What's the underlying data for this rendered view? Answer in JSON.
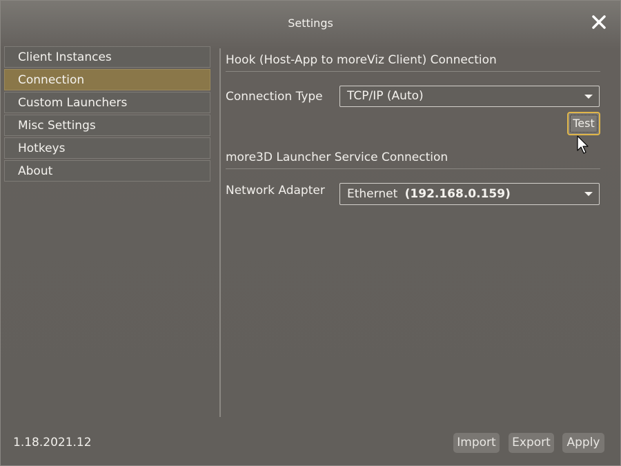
{
  "window": {
    "title": "Settings"
  },
  "icons": {
    "close": "close-icon",
    "cursor": "mouse-pointer-icon",
    "dropdown": "chevron-down-icon"
  },
  "colors": {
    "accent": "#8a7749",
    "focus_ring": "#e0b64a",
    "background": "#625f5b"
  },
  "sidebar": {
    "items": [
      {
        "label": "Client Instances",
        "selected": false
      },
      {
        "label": "Connection",
        "selected": true
      },
      {
        "label": "Custom Launchers",
        "selected": false
      },
      {
        "label": "Misc Settings",
        "selected": false
      },
      {
        "label": "Hotkeys",
        "selected": false
      },
      {
        "label": "About",
        "selected": false
      }
    ]
  },
  "hook_section": {
    "title": "Hook (Host-App to moreViz Client) Connection",
    "connection_type_label": "Connection Type",
    "connection_type_value": "TCP/IP (Auto)",
    "test_label": "Test"
  },
  "launcher_section": {
    "title": "more3D Launcher Service Connection",
    "network_adapter_label": "Network Adapter",
    "adapter_name": "Ethernet",
    "adapter_ip": "(192.168.0.159)"
  },
  "footer": {
    "version": "1.18.2021.12",
    "import_label": "Import",
    "export_label": "Export",
    "apply_label": "Apply"
  }
}
